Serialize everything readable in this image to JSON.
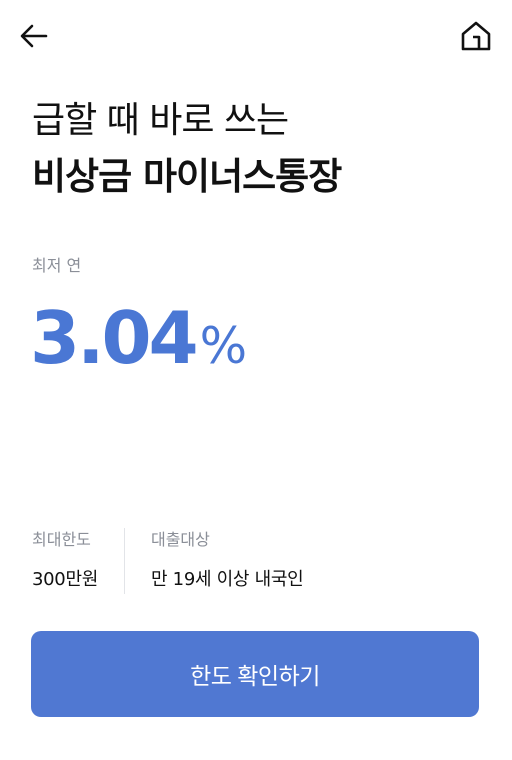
{
  "nav": {
    "back_icon": "arrow-left-icon",
    "home_icon": "home-icon"
  },
  "headline": {
    "line1": "급할 때 바로 쓰는",
    "line2": "비상금 마이너스통장"
  },
  "rate": {
    "label": "최저 연",
    "value": "3.04",
    "unit": "%"
  },
  "info": {
    "limit_label": "최대한도",
    "limit_value": "300만원",
    "target_label": "대출대상",
    "target_value": "만 19세 이상 내국인"
  },
  "cta": {
    "label": "한도 확인하기"
  },
  "colors": {
    "accent": "#4a77d4",
    "button": "#5078d2",
    "muted_text": "#8b8f98"
  }
}
